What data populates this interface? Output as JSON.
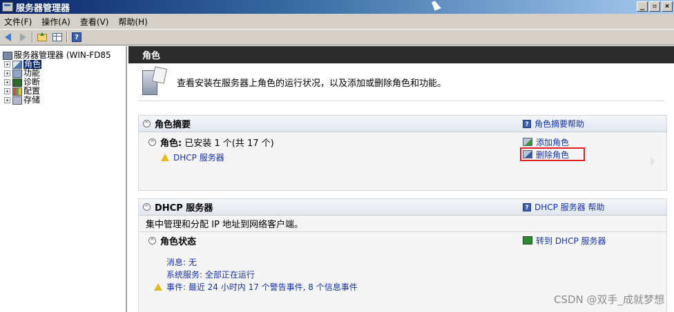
{
  "window": {
    "title": "服务器管理器"
  },
  "window_buttons": {
    "minimize": "_",
    "restore": "▫",
    "close": "×"
  },
  "menu": [
    "文件(F)",
    "操作(A)",
    "查看(V)",
    "帮助(H)"
  ],
  "tree": {
    "root": "服务器管理器 (WIN-FD85",
    "items": [
      {
        "label": "角色",
        "selected": true,
        "icon": "roles-icon"
      },
      {
        "label": "功能",
        "selected": false,
        "icon": "features-icon"
      },
      {
        "label": "诊断",
        "selected": false,
        "icon": "diagnostics-icon"
      },
      {
        "label": "配置",
        "selected": false,
        "icon": "configuration-icon"
      },
      {
        "label": "存储",
        "selected": false,
        "icon": "storage-icon"
      }
    ]
  },
  "main": {
    "header": "角色",
    "intro": "查看安装在服务器上角色的运行状况，以及添加或删除角色和功能。",
    "roles_summary": {
      "title": "角色摘要",
      "help": "角色摘要帮助",
      "roles_label": "角色:",
      "roles_status": "已安装 1 个(共 17 个)",
      "role_item": "DHCP 服务器",
      "add_role": "添加角色",
      "remove_role": "删除角色"
    },
    "dhcp": {
      "title": "DHCP 服务器",
      "help": "DHCP 服务器 帮助",
      "description": "集中管理和分配 IP 地址到网络客户端。",
      "role_status_title": "角色状态",
      "goto": "转到 DHCP 服务器",
      "messages": "消息: 无",
      "system_services": "系统服务: 全部正在运行",
      "events": "事件: 最近 24 小时内 17 个警告事件, 8 个信息事件"
    }
  },
  "watermark": "CSDN @双手_成就梦想",
  "colors": {
    "link": "#1533ad",
    "selection": "#0a246a",
    "highlight": "#e02020",
    "warning": "#e8b820"
  }
}
